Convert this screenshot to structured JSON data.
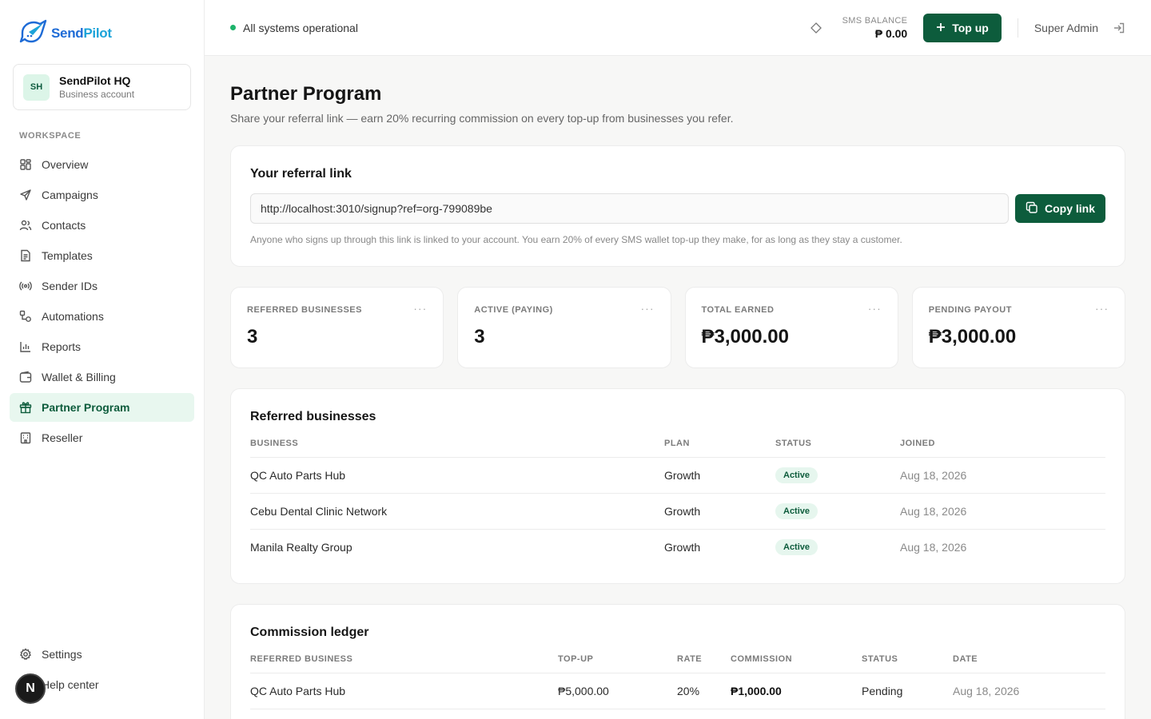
{
  "brand": {
    "name_part1": "Send",
    "name_part2": "Pilot"
  },
  "account": {
    "initials": "SH",
    "name": "SendPilot HQ",
    "type": "Business account"
  },
  "sidebar": {
    "section_label": "WORKSPACE",
    "items": [
      {
        "label": "Overview",
        "icon": "grid-icon"
      },
      {
        "label": "Campaigns",
        "icon": "send-icon"
      },
      {
        "label": "Contacts",
        "icon": "users-icon"
      },
      {
        "label": "Templates",
        "icon": "file-icon"
      },
      {
        "label": "Sender IDs",
        "icon": "broadcast-icon"
      },
      {
        "label": "Automations",
        "icon": "workflow-icon"
      },
      {
        "label": "Reports",
        "icon": "bar-chart-icon"
      },
      {
        "label": "Wallet & Billing",
        "icon": "wallet-icon"
      },
      {
        "label": "Partner Program",
        "icon": "gift-icon",
        "active": true
      },
      {
        "label": "Reseller",
        "icon": "building-icon"
      }
    ],
    "bottom": [
      {
        "label": "Settings",
        "icon": "gear-icon"
      },
      {
        "label": "Help center",
        "icon": "help-icon"
      }
    ],
    "badge_letter": "N"
  },
  "topbar": {
    "status": "All systems operational",
    "balance_label": "SMS BALANCE",
    "balance_value": "₱ 0.00",
    "topup_label": "Top up",
    "user": "Super Admin"
  },
  "page": {
    "title": "Partner Program",
    "subtitle": "Share your referral link — earn 20% recurring commission on every top-up from businesses you refer."
  },
  "referral": {
    "title": "Your referral link",
    "link": "http://localhost:3010/signup?ref=org-799089be",
    "copy_label": "Copy link",
    "note": "Anyone who signs up through this link is linked to your account. You earn 20% of every SMS wallet top-up they make, for as long as they stay a customer."
  },
  "stats": [
    {
      "label": "REFERRED BUSINESSES",
      "value": "3"
    },
    {
      "label": "ACTIVE (PAYING)",
      "value": "3"
    },
    {
      "label": "TOTAL EARNED",
      "value": "₱3,000.00"
    },
    {
      "label": "PENDING PAYOUT",
      "value": "₱3,000.00"
    }
  ],
  "referred": {
    "title": "Referred businesses",
    "columns": [
      "BUSINESS",
      "PLAN",
      "STATUS",
      "JOINED"
    ],
    "rows": [
      {
        "business": "QC Auto Parts Hub",
        "plan": "Growth",
        "status": "Active",
        "joined": "Aug 18, 2026"
      },
      {
        "business": "Cebu Dental Clinic Network",
        "plan": "Growth",
        "status": "Active",
        "joined": "Aug 18, 2026"
      },
      {
        "business": "Manila Realty Group",
        "plan": "Growth",
        "status": "Active",
        "joined": "Aug 18, 2026"
      }
    ]
  },
  "ledger": {
    "title": "Commission ledger",
    "columns": [
      "REFERRED BUSINESS",
      "TOP-UP",
      "RATE",
      "COMMISSION",
      "STATUS",
      "DATE"
    ],
    "rows": [
      {
        "business": "QC Auto Parts Hub",
        "topup": "₱5,000.00",
        "rate": "20%",
        "commission": "₱1,000.00",
        "status": "Pending",
        "date": "Aug 18, 2026"
      }
    ]
  },
  "colors": {
    "accent": "#0d5c3c",
    "accent_light": "#e8f7ef",
    "status_green": "#1db36b",
    "brand_blue": "#1e6bd6"
  }
}
